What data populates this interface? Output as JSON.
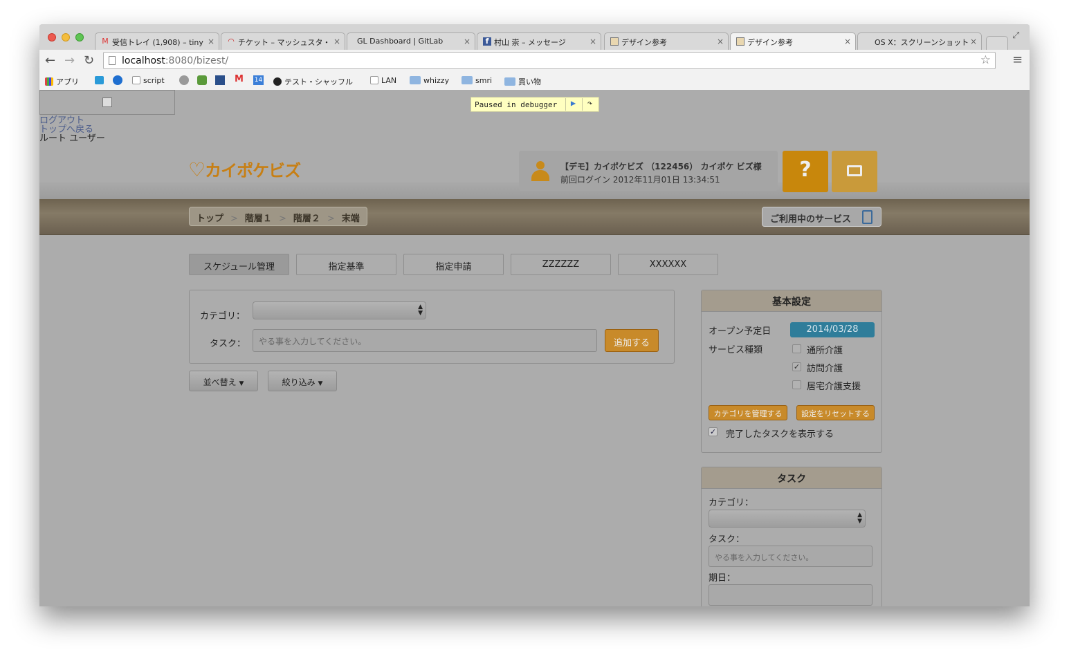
{
  "browser": {
    "tabs": [
      {
        "label": "受信トレイ (1,908) – tiny",
        "icon": "gmail-icon"
      },
      {
        "label": "チケット – マッシュスタ・",
        "icon": "redmine-icon"
      },
      {
        "label": "GL Dashboard | GitLab",
        "icon": "gitlab-icon"
      },
      {
        "label": "村山 崇 – メッセージ",
        "icon": "facebook-icon"
      },
      {
        "label": "デザイン参考",
        "icon": "image-icon"
      },
      {
        "label": "デザイン参考",
        "icon": "image-icon"
      },
      {
        "label": "OS X：スクリーンショット",
        "icon": "apple-icon"
      }
    ],
    "url_host": "localhost",
    "url_rest": ":8080/bizest/",
    "bookmarks": [
      "アプリ",
      "script",
      "テスト・シャッフル",
      "LAN",
      "whizzy",
      "smri",
      "買い物"
    ],
    "bookmark_badge": "14"
  },
  "page": {
    "links": [
      "ログアウト",
      "トップへ戻る"
    ],
    "root_user": "ルート ユーザー",
    "debugger": "Paused in debugger",
    "logo_text": "カイポケビズ",
    "user_name": "【デモ】カイポケビズ （122456） カイポケ ビズ様",
    "last_login": "前回ログイン 2012年11月01日 13:34:51",
    "breadcrumb": [
      "トップ",
      "階層１",
      "階層２",
      "末端"
    ],
    "service_button": "ご利用中のサービス",
    "tabs": [
      "スケジュール管理",
      "指定基準",
      "指定申請",
      "ZZZZZZ",
      "XXXXXX"
    ],
    "form": {
      "category_label": "カテゴリ：",
      "task_label": "タスク：",
      "task_placeholder": "やる事を入力してください。",
      "add_button": "追加する",
      "sort_button": "並べ替え",
      "filter_button": "絞り込み"
    },
    "settings": {
      "title": "基本設定",
      "open_label": "オープン予定日",
      "open_date": "2014/03/28",
      "service_label": "サービス種類",
      "services": [
        {
          "label": "通所介護",
          "checked": false
        },
        {
          "label": "訪問介護",
          "checked": true
        },
        {
          "label": "居宅介護支援",
          "checked": false
        }
      ],
      "manage_category": "カテゴリを管理する",
      "reset_settings": "設定をリセットする",
      "show_done": "完了したタスクを表示する"
    },
    "task_panel": {
      "title": "タスク",
      "category_label": "カテゴリ：",
      "task_label": "タスク：",
      "task_placeholder": "やる事を入力してください。",
      "due_label": "期日："
    }
  }
}
